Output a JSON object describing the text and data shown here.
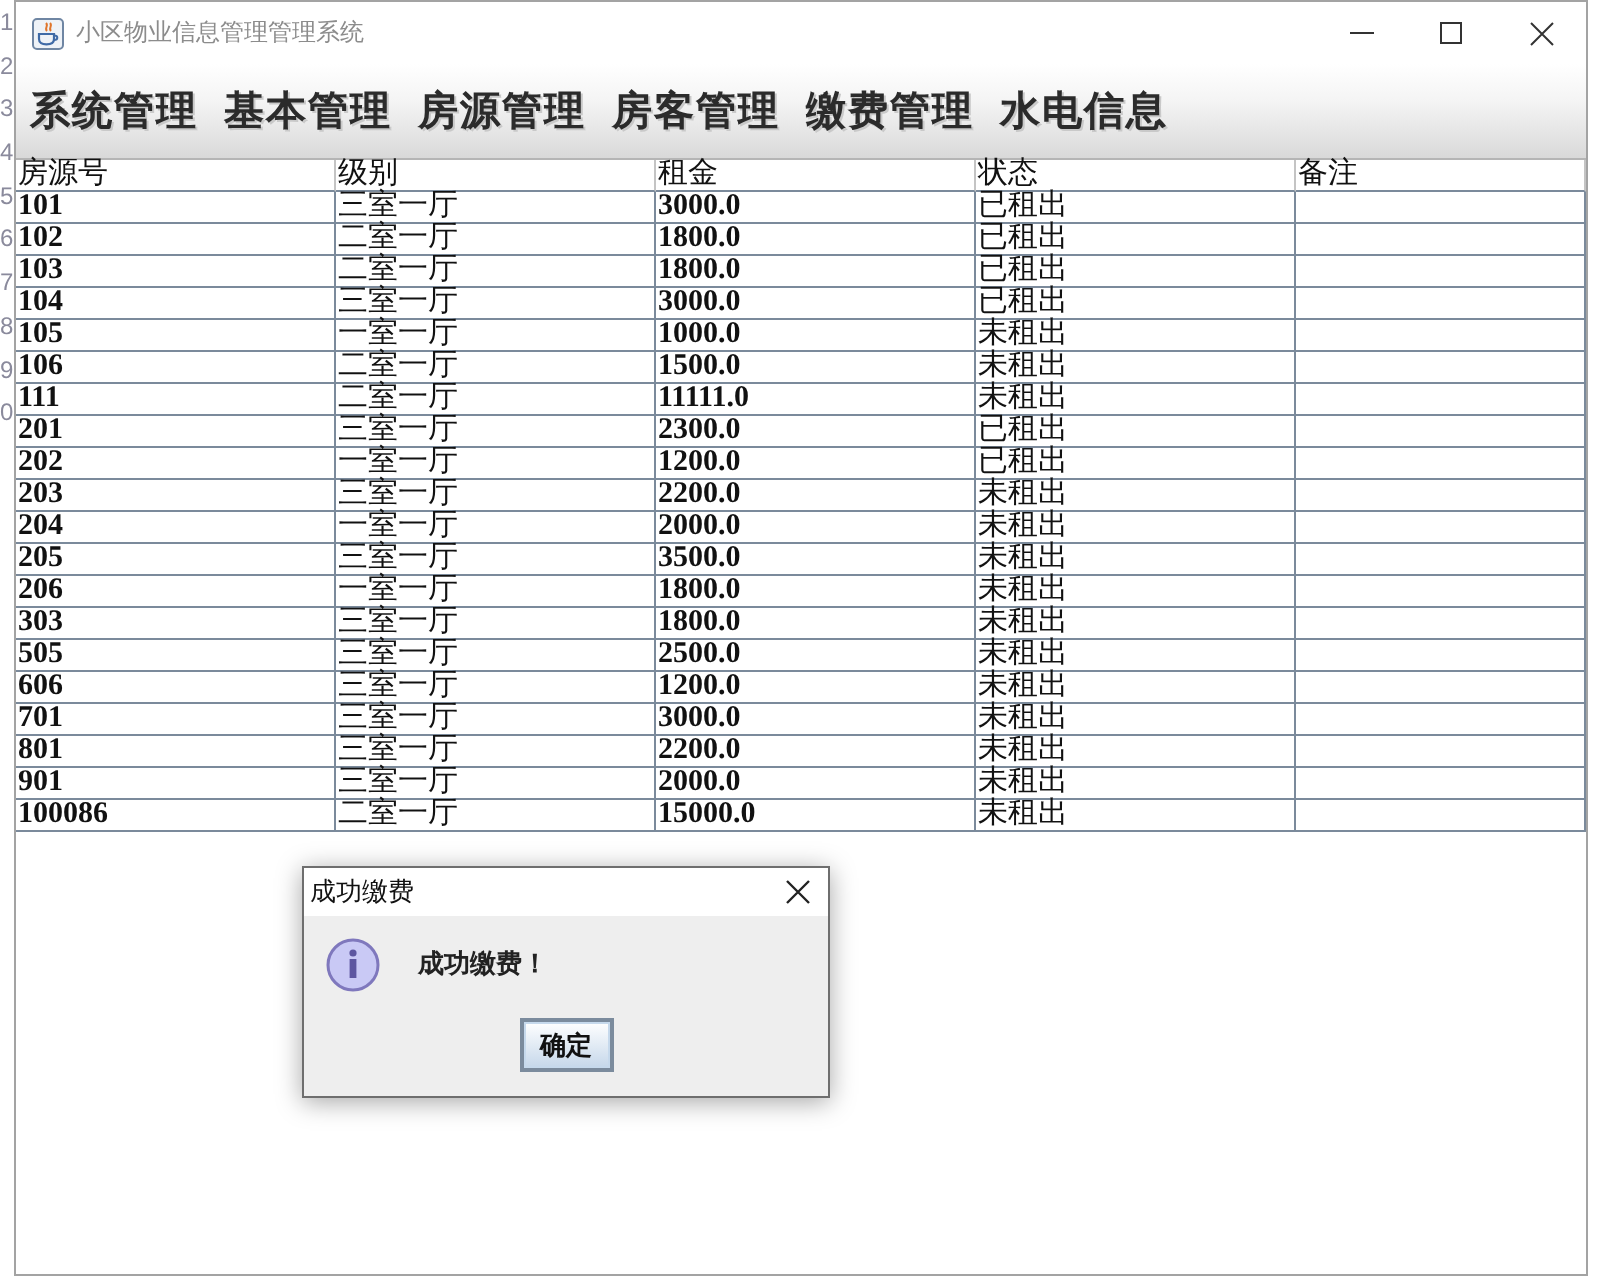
{
  "background_editor": {
    "line_numbers": [
      "1",
      "2",
      "3",
      "4",
      "5",
      "6",
      "7",
      "8",
      "9",
      "0"
    ]
  },
  "window": {
    "title": "小区物业信息管理管理系统"
  },
  "menu_bar": {
    "items": [
      "系统管理",
      "基本管理",
      "房源管理",
      "房客管理",
      "缴费管理",
      "水电信息"
    ]
  },
  "table": {
    "columns": [
      "房源号",
      "级别",
      "租金",
      "状态",
      "备注"
    ],
    "rows": [
      [
        "101",
        "三室一厅",
        "3000.0",
        "已租出"
      ],
      [
        "102",
        "二室一厅",
        "1800.0",
        "已租出"
      ],
      [
        "103",
        "二室一厅",
        "1800.0",
        "已租出"
      ],
      [
        "104",
        "三室一厅",
        "3000.0",
        "已租出"
      ],
      [
        "105",
        "一室一厅",
        "1000.0",
        "未租出"
      ],
      [
        "106",
        "二室一厅",
        "1500.0",
        "未租出"
      ],
      [
        "111",
        "二室一厅",
        "11111.0",
        "未租出"
      ],
      [
        "201",
        "三室一厅",
        "2300.0",
        "已租出"
      ],
      [
        "202",
        "一室一厅",
        "1200.0",
        "已租出"
      ],
      [
        "203",
        "三室一厅",
        "2200.0",
        "未租出"
      ],
      [
        "204",
        "一室一厅",
        "2000.0",
        "未租出"
      ],
      [
        "205",
        "三室一厅",
        "3500.0",
        "未租出"
      ],
      [
        "206",
        "一室一厅",
        "1800.0",
        "未租出"
      ],
      [
        "303",
        "三室一厅",
        "1800.0",
        "未租出"
      ],
      [
        "505",
        "三室一厅",
        "2500.0",
        "未租出"
      ],
      [
        "606",
        "三室一厅",
        "1200.0",
        "未租出"
      ],
      [
        "701",
        "三室一厅",
        "3000.0",
        "未租出"
      ],
      [
        "801",
        "三室一厅",
        "2200.0",
        "未租出"
      ],
      [
        "901",
        "三室一厅",
        "2000.0",
        "未租出"
      ],
      [
        "100086",
        "二室一厅",
        "15000.0",
        "未租出"
      ]
    ]
  },
  "dialog": {
    "title": "成功缴费",
    "message": "成功缴费！",
    "buttons": [
      "确定"
    ]
  }
}
